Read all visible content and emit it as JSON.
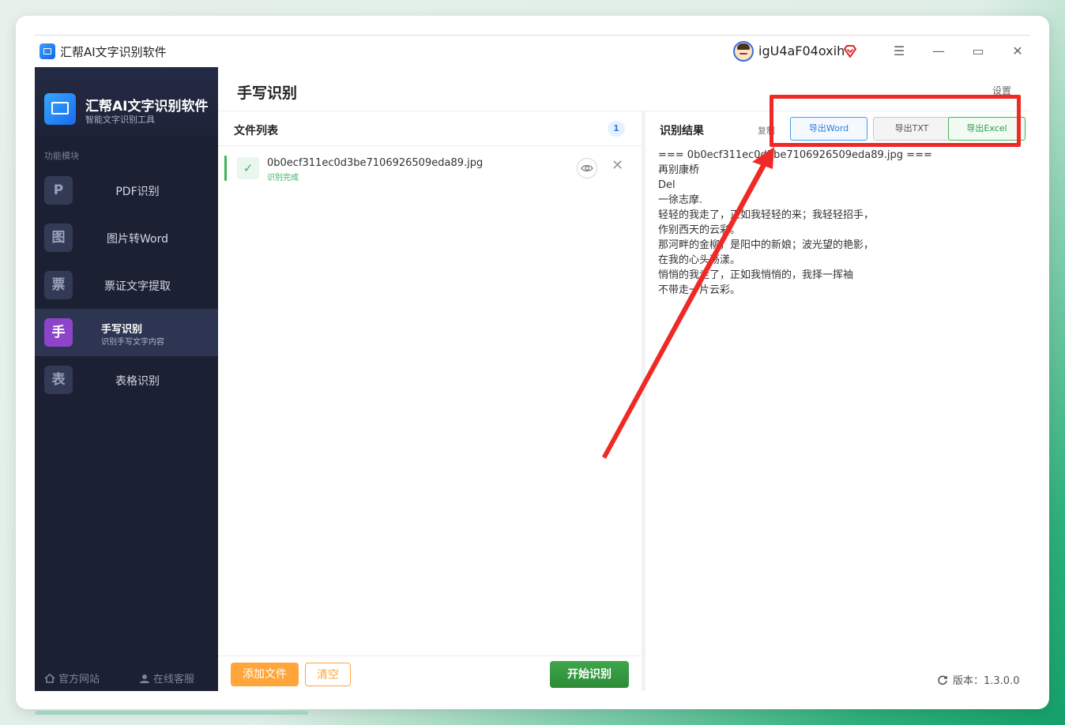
{
  "window": {
    "title": "汇帮AI文字识别软件",
    "username": "igU4aF04oxih",
    "controls": {
      "menu": "☰",
      "minimize": "—",
      "maximize": "▭",
      "close": "✕"
    }
  },
  "sidebar": {
    "app_name": "汇帮AI文字识别软件",
    "app_subtitle": "智能文字识别工具",
    "section_label": "功能模块",
    "items": [
      {
        "badge": "P",
        "label": "PDF识别",
        "desc": ""
      },
      {
        "badge": "图",
        "label": "图片转Word",
        "desc": ""
      },
      {
        "badge": "票",
        "label": "票证文字提取",
        "desc": ""
      },
      {
        "badge": "手",
        "label": "手写识别",
        "desc": "识别手写文字内容"
      },
      {
        "badge": "表",
        "label": "表格识别",
        "desc": ""
      }
    ],
    "footer": {
      "website": "官方网站",
      "support": "在线客服"
    }
  },
  "main": {
    "title": "手写识别",
    "settings": "设置"
  },
  "file_panel": {
    "title": "文件列表",
    "count": "1",
    "files": [
      {
        "name": "0b0ecf311ec0d3be7106926509eda89.jpg",
        "status": "识别完成"
      }
    ],
    "add_button": "添加文件",
    "clear_button": "清空",
    "start_button": "开始识别"
  },
  "result_panel": {
    "title": "识别结果",
    "copy": "复制",
    "export_word": "导出Word",
    "export_txt": "导出TXT",
    "export_excel": "导出Excel",
    "lines": [
      "=== 0b0ecf311ec0d3be7106926509eda89.jpg ===",
      "再别康桥",
      "Del",
      "一徐志摩.",
      "轻轻的我走了，正如我轻轻的来；我轻轻招手，",
      "作别西天的云彩。",
      "那河畔的金柳，是阳中的新娘；波光望的艳影，",
      "在我的心头荡漾。",
      "悄悄的我走了，正如我悄悄的，我择一挥袖",
      "不带走一片云彩。"
    ]
  },
  "version": "版本：1.3.0.0",
  "colors": {
    "sidebar_bg": "#1c2033",
    "active_badge": "#8e44c9",
    "orange": "#ffa53a",
    "green": "#3fa64a",
    "annotation": "#ef2a26"
  }
}
